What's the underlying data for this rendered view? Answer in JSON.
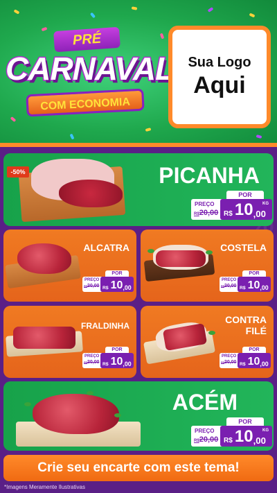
{
  "header": {
    "badge_top": "PRÉ",
    "title": "CARNAVAL",
    "subtitle": "COM ECONOMIA",
    "logo_line1": "Sua Logo",
    "logo_line2": "Aqui"
  },
  "products": [
    {
      "name": "PICANHA",
      "por": "POR",
      "preco": "PREÇO",
      "old_prefix": "R$",
      "old": "20,00",
      "rs": "R$",
      "int": "10",
      "dec": ",00",
      "kg": "KG",
      "discount": "-50%"
    },
    {
      "name": "ALCATRA",
      "por": "POR",
      "preco": "PREÇO",
      "old_prefix": "R$",
      "old": "20,00",
      "rs": "R$",
      "int": "10",
      "dec": ",00"
    },
    {
      "name": "COSTELA",
      "por": "POR",
      "preco": "PREÇO",
      "old_prefix": "R$",
      "old": "20,00",
      "rs": "R$",
      "int": "10",
      "dec": ",00"
    },
    {
      "name": "FRALDINHA",
      "por": "POR",
      "preco": "PREÇO",
      "old_prefix": "R$",
      "old": "20,00",
      "rs": "R$",
      "int": "10",
      "dec": ",00"
    },
    {
      "name_line1": "CONTRA",
      "name_line2": "FILÉ",
      "por": "POR",
      "preco": "PREÇO",
      "old_prefix": "R$",
      "old": "20,00",
      "rs": "R$",
      "int": "10",
      "dec": ",00"
    },
    {
      "name": "ACÉM",
      "por": "POR",
      "preco": "PREÇO",
      "old_prefix": "R$",
      "old": "20,00",
      "rs": "R$",
      "int": "10",
      "dec": ",00",
      "kg": "KG"
    }
  ],
  "cta": "Crie seu encarte com este tema!",
  "footnote": "*Imagens Meramente Ilustrativas",
  "colors": {
    "green": "#1fa84d",
    "orange": "#f07a22",
    "purple": "#7a1fb0",
    "background": "#5a1f86"
  }
}
